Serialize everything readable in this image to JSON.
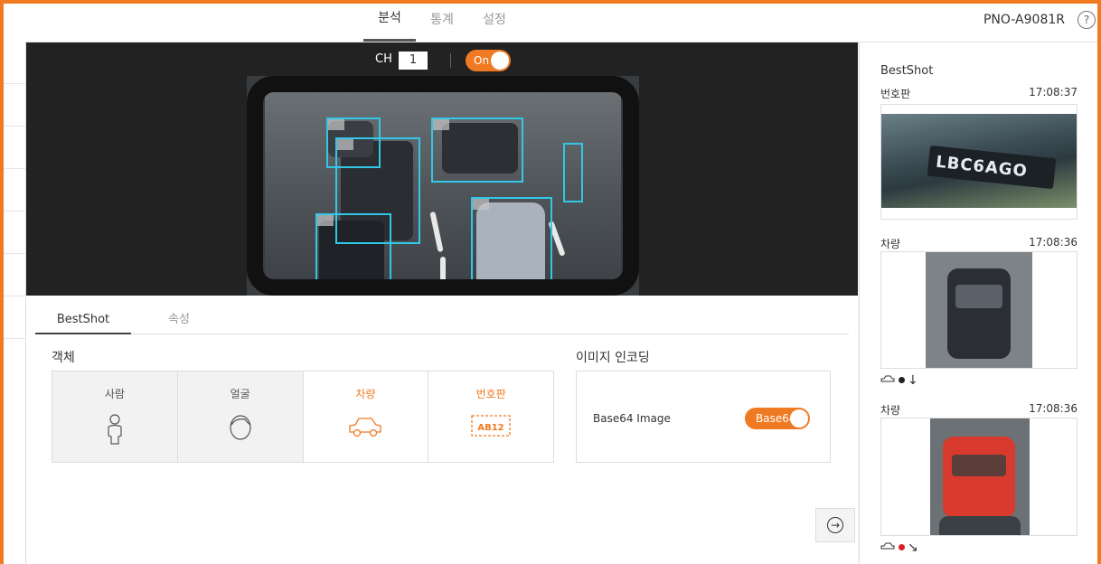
{
  "topbar": {
    "tabs": [
      {
        "label": "분석",
        "active": true
      },
      {
        "label": "통계",
        "active": false
      },
      {
        "label": "설정",
        "active": false
      }
    ],
    "model": "PNO-A9081R",
    "help_glyph": "?"
  },
  "video": {
    "ch_label": "CH",
    "ch_value": "1",
    "toggle_label": "On"
  },
  "panel": {
    "tabs": [
      {
        "label": "BestShot",
        "active": true
      },
      {
        "label": "속성",
        "active": false
      }
    ],
    "object_title": "객체",
    "objects": [
      {
        "label": "사람",
        "selected": false,
        "icon": "person-icon"
      },
      {
        "label": "얼굴",
        "selected": false,
        "icon": "face-icon"
      },
      {
        "label": "차량",
        "selected": true,
        "icon": "car-icon"
      },
      {
        "label": "번호판",
        "selected": true,
        "icon": "license-plate-icon",
        "plate_text": "AB12"
      }
    ],
    "encoding_title": "이미지 인코딩",
    "encoding_label": "Base64 Image",
    "encoding_toggle": "Base64",
    "next_glyph": "→"
  },
  "bestshot": {
    "title": "BestShot",
    "items": [
      {
        "type": "번호판",
        "time": "17:08:37",
        "plate_text": "LBC6AGO"
      },
      {
        "type": "차량",
        "time": "17:08:36",
        "arrow": "↓",
        "dot_color": "#222222"
      },
      {
        "type": "차량",
        "time": "17:08:36",
        "arrow": "↘",
        "dot_color": "#e02020"
      }
    ]
  },
  "colors": {
    "accent": "#f07a22",
    "detection_box": "#30c8e6"
  }
}
